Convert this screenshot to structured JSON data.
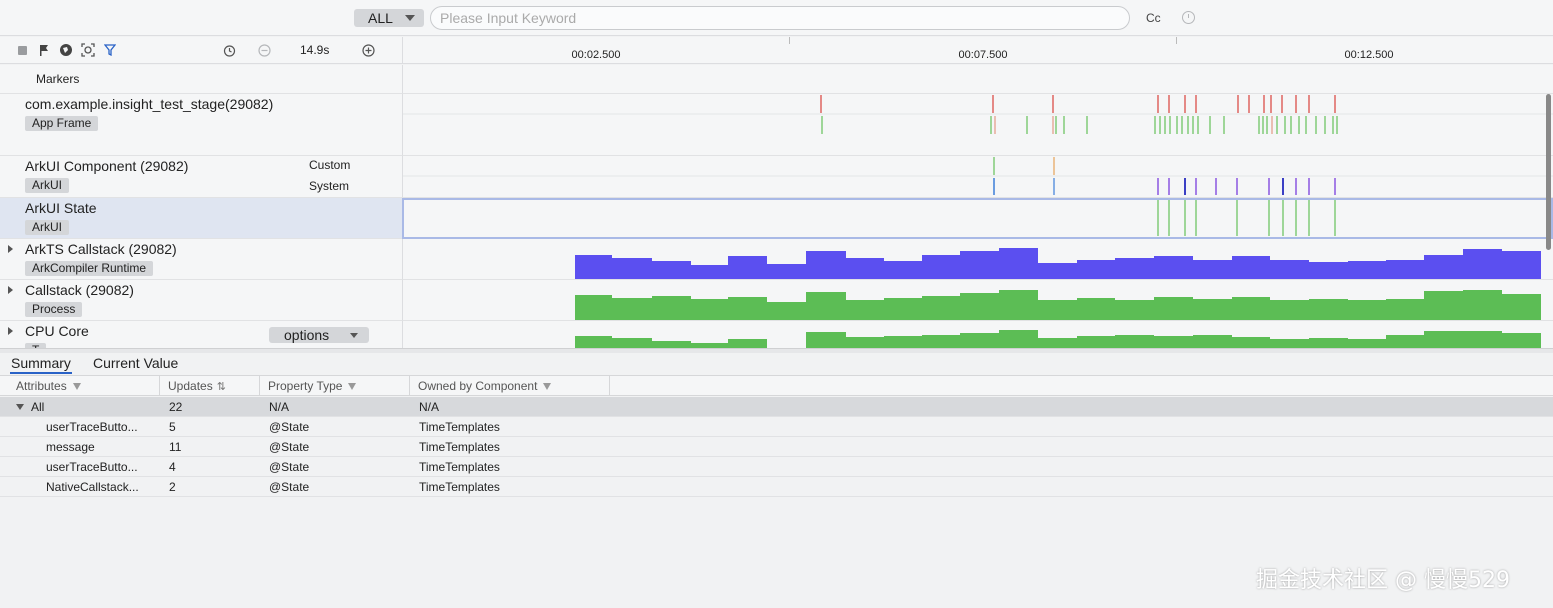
{
  "search": {
    "filter_value": "ALL",
    "placeholder": "Please Input Keyword",
    "case_label": "Cc"
  },
  "toolbar": {
    "zoom_value": "14.9s"
  },
  "ruler": {
    "ticks": [
      "00:02.500",
      "00:07.500",
      "00:12.500"
    ]
  },
  "lanes": {
    "markers": {
      "title": "Markers"
    },
    "app": {
      "title": "com.example.insight_test_stage(29082)",
      "tag": "App Frame"
    },
    "arkui_component": {
      "title": "ArkUI Component (29082)",
      "tag": "ArkUI",
      "sub1": "Custom",
      "sub2": "System"
    },
    "arkui_state": {
      "title": "ArkUI State",
      "tag": "ArkUI"
    },
    "arkts": {
      "title": "ArkTS Callstack (29082)",
      "tag": "ArkCompiler Runtime"
    },
    "callstack": {
      "title": "Callstack (29082)",
      "tag": "Process"
    },
    "cpu": {
      "title": "CPU Core",
      "tag": "T",
      "options_label": "options"
    }
  },
  "colors": {
    "red_marker": "#d9413b",
    "green_marker": "#63c15a",
    "blue_marker": "#3b7fd9",
    "purple_marker": "#7a3fdc",
    "arkts_fill": "#5b4ff0",
    "callstack_fill": "#5cbd55"
  },
  "tabs": {
    "summary": "Summary",
    "current_value": "Current Value"
  },
  "table": {
    "headers": {
      "attributes": "Attributes",
      "updates": "Updates",
      "property_type": "Property Type",
      "owned_by": "Owned by Component"
    },
    "group": {
      "name": "All",
      "updates": "22",
      "type": "N/A",
      "owner": "N/A"
    },
    "rows": [
      {
        "name": "userTraceButto...",
        "updates": "5",
        "type": "@State",
        "owner": "TimeTemplates"
      },
      {
        "name": "message",
        "updates": "11",
        "type": "@State",
        "owner": "TimeTemplates"
      },
      {
        "name": "userTraceButto...",
        "updates": "4",
        "type": "@State",
        "owner": "TimeTemplates"
      },
      {
        "name": "NativeCallstack...",
        "updates": "2",
        "type": "@State",
        "owner": "TimeTemplates"
      }
    ]
  },
  "watermark": "掘金技术社区 @ 慢慢529"
}
